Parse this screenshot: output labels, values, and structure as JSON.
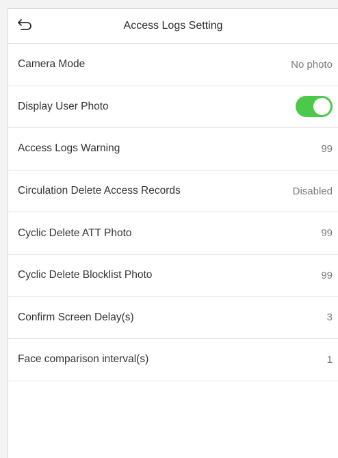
{
  "header": {
    "title": "Access Logs Setting",
    "back_icon": "back-arrow-icon"
  },
  "colors": {
    "toggle_on": "#4cc94b",
    "divider": "#e2e2e2",
    "value_text": "#7a7a7a"
  },
  "settings": [
    {
      "label": "Camera Mode",
      "value": "No photo",
      "control": "text"
    },
    {
      "label": "Display User Photo",
      "value": "on",
      "control": "toggle"
    },
    {
      "label": "Access Logs Warning",
      "value": "99",
      "control": "text"
    },
    {
      "label": "Circulation Delete Access Records",
      "value": "Disabled",
      "control": "text"
    },
    {
      "label": "Cyclic Delete ATT Photo",
      "value": "99",
      "control": "text"
    },
    {
      "label": "Cyclic Delete Blocklist Photo",
      "value": "99",
      "control": "text"
    },
    {
      "label": "Confirm Screen Delay(s)",
      "value": "3",
      "control": "text"
    },
    {
      "label": "Face comparison interval(s)",
      "value": "1",
      "control": "text"
    }
  ]
}
